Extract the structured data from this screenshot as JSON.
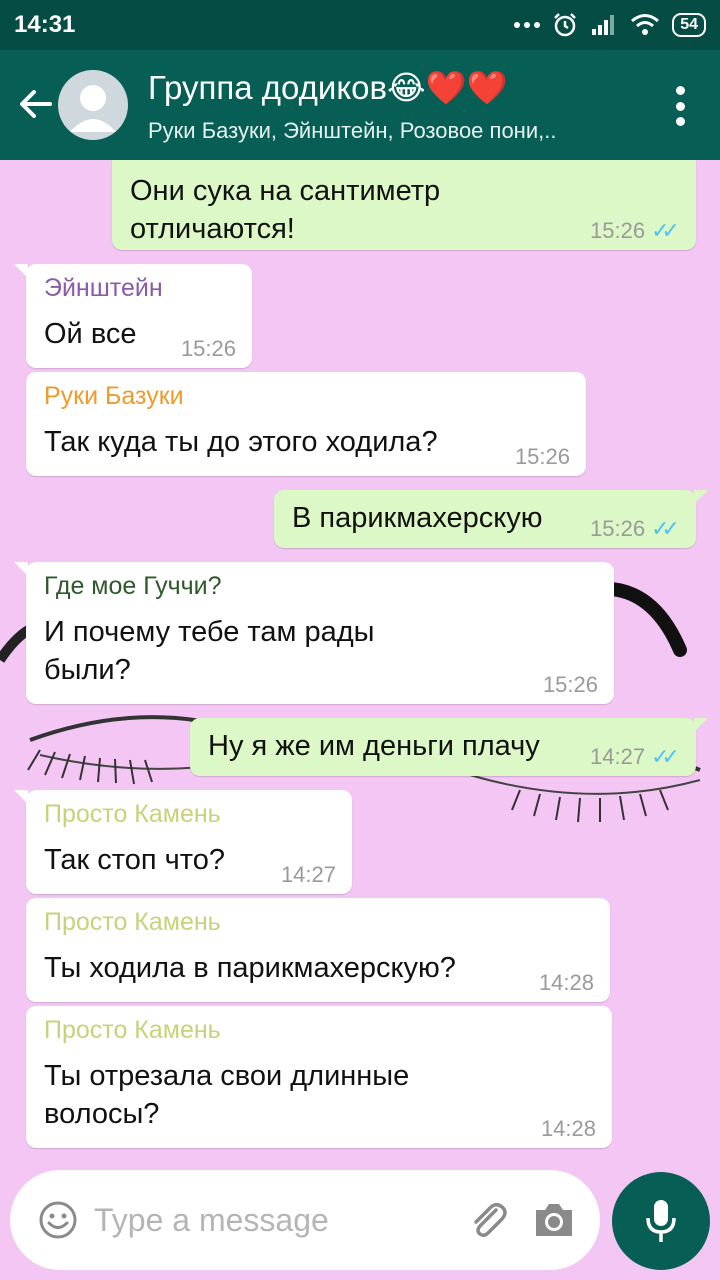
{
  "status_bar": {
    "time": "14:31",
    "battery": "54"
  },
  "header": {
    "title": "Группа додиков😂❤️❤️",
    "subtitle": "Руки Базуки, Эйнштейн, Розовое пони,.."
  },
  "messages": [
    {
      "direction": "out",
      "text": "Они сука на сантиметр отличаются!",
      "time": "15:26",
      "status": "read"
    },
    {
      "direction": "in",
      "sender": "Эйнштейн",
      "sender_color": "#8b5aa8",
      "text": "Ой все",
      "time": "15:26"
    },
    {
      "direction": "in",
      "sender": "Руки Базуки",
      "sender_color": "#f09a2c",
      "text": "Так куда ты до этого ходила?",
      "time": "15:26"
    },
    {
      "direction": "out",
      "text": "В парикмахерскую",
      "time": "15:26",
      "status": "read"
    },
    {
      "direction": "in",
      "sender": "Где мое Гуччи?",
      "sender_color": "#2e5a2a",
      "text": "И почему тебе там рады были?",
      "time": "15:26"
    },
    {
      "direction": "out",
      "text": "Ну я же им деньги плачу",
      "time": "14:27",
      "status": "read"
    },
    {
      "direction": "in",
      "sender": "Просто Камень",
      "sender_color": "#c8d27a",
      "text": "Так стоп что?",
      "time": "14:27"
    },
    {
      "direction": "in",
      "sender": "Просто Камень",
      "sender_color": "#c8d27a",
      "text": "Ты ходила в парикмахерскую?",
      "time": "14:28"
    },
    {
      "direction": "in",
      "sender": "Просто Камень",
      "sender_color": "#c8d27a",
      "text": "Ты отрезала свои длинные волосы?",
      "time": "14:28"
    }
  ],
  "input": {
    "placeholder": "Type a message"
  },
  "colors": {
    "header": "#075e54",
    "status_bar": "#054d44",
    "chat_bg": "#f3c6f3",
    "out_bubble": "#dcf8c6",
    "ticks": "#4fc3f7"
  },
  "icons": [
    "back-arrow-icon",
    "avatar-icon",
    "more-vert-icon",
    "emoji-icon",
    "attach-icon",
    "camera-icon",
    "mic-icon",
    "read-ticks-icon"
  ]
}
